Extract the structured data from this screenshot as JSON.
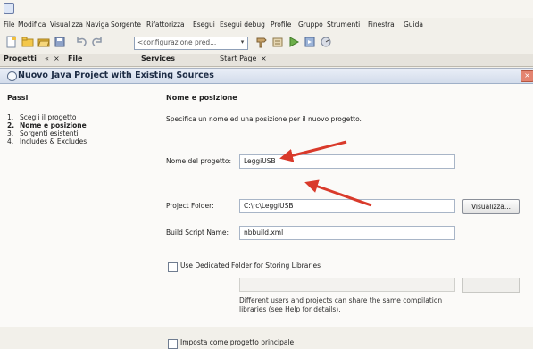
{
  "window": {
    "title": ""
  },
  "menu": [
    "File",
    "Modifica",
    "Visualizza",
    "Naviga",
    "Sorgente",
    "Rifattorizza",
    "Esegui",
    "Esegui debug",
    "Profile",
    "Gruppo",
    "Strumenti",
    "Finestra",
    "Guida"
  ],
  "toolbar": {
    "config_value": "<configurazione pred..."
  },
  "panel_tabs": {
    "projects": "Progetti",
    "files": "File",
    "services": "Services",
    "start_page": "Start Page"
  },
  "dialog": {
    "title": "Nuovo Java Project with Existing Sources",
    "close_label": "×",
    "steps_heading": "Passi",
    "steps": [
      {
        "num": "1.",
        "label": "Scegli il progetto"
      },
      {
        "num": "2.",
        "label": "Nome e posizione"
      },
      {
        "num": "3.",
        "label": "Sorgenti esistenti"
      },
      {
        "num": "4.",
        "label": "Includes & Excludes"
      }
    ],
    "section_heading": "Nome e posizione",
    "instruction": "Specifica un nome ed una posizione per il nuovo progetto.",
    "fields": {
      "project_name": {
        "label": "Nome del progetto:",
        "value": "LeggiUSB"
      },
      "project_folder": {
        "label": "Project Folder:",
        "value": "C:\\rc\\LeggiUSB"
      },
      "build_script": {
        "label": "Build Script Name:",
        "value": "nbbuild.xml"
      }
    },
    "browse_label": "Visualizza...",
    "dedicated_folder_label": "Use Dedicated Folder for Storing Libraries",
    "libraries_browse_label": "",
    "help_lines": [
      "Different users and projects can share the same compilation",
      "libraries (see Help for details)."
    ],
    "main_project_label": "Imposta come progetto principale"
  },
  "colors": {
    "annotation_arrow": "#d93a2b",
    "dialog_header": "#d3dceb"
  }
}
